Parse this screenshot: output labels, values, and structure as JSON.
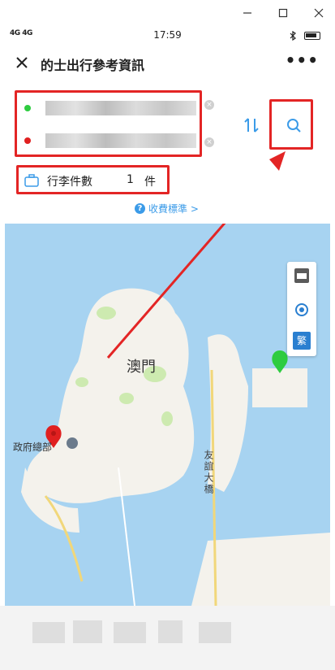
{
  "window": {
    "minimize_icon": "minimize-icon",
    "maximize_icon": "maximize-icon",
    "close_icon": "close-icon"
  },
  "status_bar": {
    "signal": "4G 4G",
    "time": "17:59",
    "bluetooth_icon": "bluetooth-icon"
  },
  "header": {
    "title": "的士出行參考資訊",
    "more": "•••"
  },
  "form": {
    "origin_dot_color": "#2ecc40",
    "destination_dot_color": "#e02020",
    "luggage_label": "行李件數",
    "luggage_count": "1",
    "luggage_unit": "件",
    "fee_link": "收費標準 >"
  },
  "map": {
    "macau_label": "澳門",
    "government_label": "政府總部",
    "bridge_label": "友誼大橋",
    "lang_button": "繁",
    "water_color": "#a7d3f1",
    "land_color": "#f4f2ec",
    "green_color": "#cdeab0"
  },
  "colors": {
    "accent": "#3b9be8",
    "annotation": "#e32525"
  }
}
